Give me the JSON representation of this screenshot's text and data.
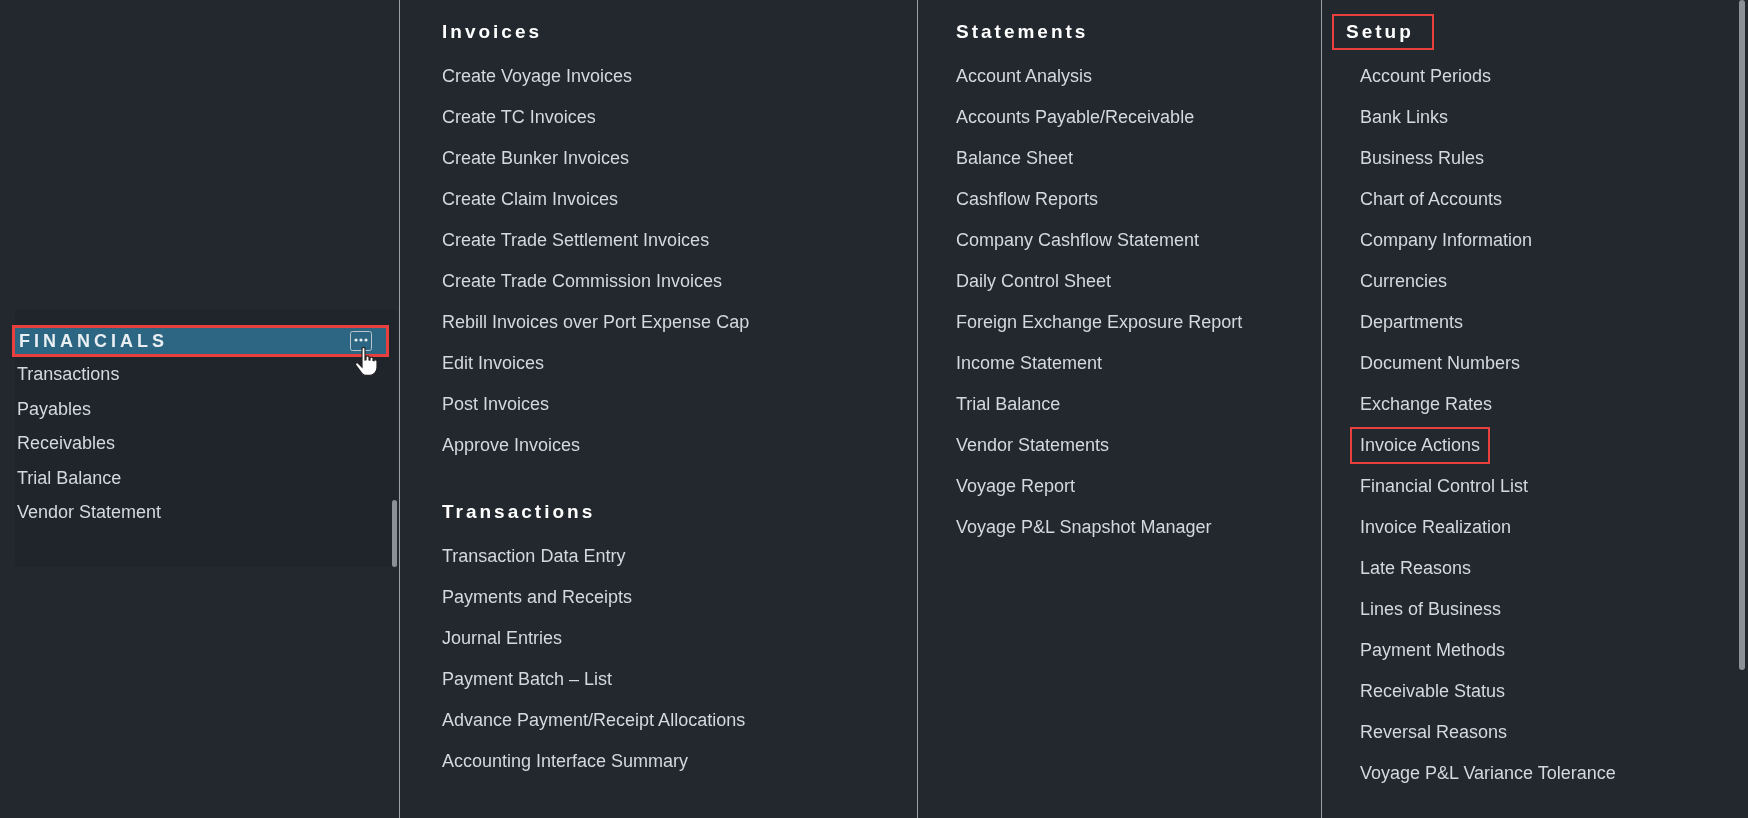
{
  "sidebar": {
    "section": {
      "label": "FINANCIALS",
      "selected": true,
      "highlighted": true
    },
    "items": [
      {
        "label": "Transactions"
      },
      {
        "label": "Payables"
      },
      {
        "label": "Receivables"
      },
      {
        "label": "Trial Balance"
      },
      {
        "label": "Vendor Statement"
      }
    ]
  },
  "menu_columns": [
    {
      "sections": [
        {
          "heading": "Invoices",
          "highlighted": false,
          "items": [
            {
              "label": "Create Voyage Invoices",
              "highlighted": false
            },
            {
              "label": "Create TC Invoices",
              "highlighted": false
            },
            {
              "label": "Create Bunker Invoices",
              "highlighted": false
            },
            {
              "label": "Create Claim Invoices",
              "highlighted": false
            },
            {
              "label": "Create Trade Settlement Invoices",
              "highlighted": false
            },
            {
              "label": "Create Trade Commission Invoices",
              "highlighted": false
            },
            {
              "label": "Rebill Invoices over Port Expense Cap",
              "highlighted": false
            },
            {
              "label": "Edit Invoices",
              "highlighted": false
            },
            {
              "label": "Post Invoices",
              "highlighted": false
            },
            {
              "label": "Approve Invoices",
              "highlighted": false
            }
          ]
        },
        {
          "heading": "Transactions",
          "highlighted": false,
          "items": [
            {
              "label": "Transaction Data Entry",
              "highlighted": false
            },
            {
              "label": "Payments and Receipts",
              "highlighted": false
            },
            {
              "label": "Journal Entries",
              "highlighted": false
            },
            {
              "label": "Payment Batch – List",
              "highlighted": false
            },
            {
              "label": "Advance Payment/Receipt Allocations",
              "highlighted": false
            },
            {
              "label": "Accounting Interface Summary",
              "highlighted": false
            }
          ]
        }
      ]
    },
    {
      "sections": [
        {
          "heading": "Statements",
          "highlighted": false,
          "items": [
            {
              "label": "Account Analysis",
              "highlighted": false
            },
            {
              "label": "Accounts Payable/Receivable",
              "highlighted": false
            },
            {
              "label": "Balance Sheet",
              "highlighted": false
            },
            {
              "label": "Cashflow Reports",
              "highlighted": false
            },
            {
              "label": "Company Cashflow Statement",
              "highlighted": false
            },
            {
              "label": "Daily Control Sheet",
              "highlighted": false
            },
            {
              "label": "Foreign Exchange Exposure Report",
              "highlighted": false
            },
            {
              "label": "Income Statement",
              "highlighted": false
            },
            {
              "label": "Trial Balance",
              "highlighted": false
            },
            {
              "label": "Vendor Statements",
              "highlighted": false
            },
            {
              "label": "Voyage Report",
              "highlighted": false
            },
            {
              "label": "Voyage P&L Snapshot Manager",
              "highlighted": false
            }
          ]
        }
      ]
    },
    {
      "sections": [
        {
          "heading": "Setup",
          "highlighted": true,
          "items": [
            {
              "label": "Account Periods",
              "highlighted": false
            },
            {
              "label": "Bank Links",
              "highlighted": false
            },
            {
              "label": "Business Rules",
              "highlighted": false
            },
            {
              "label": "Chart of Accounts",
              "highlighted": false
            },
            {
              "label": "Company Information",
              "highlighted": false
            },
            {
              "label": "Currencies",
              "highlighted": false
            },
            {
              "label": "Departments",
              "highlighted": false
            },
            {
              "label": "Document Numbers",
              "highlighted": false
            },
            {
              "label": "Exchange Rates",
              "highlighted": false
            },
            {
              "label": "Invoice Actions",
              "highlighted": true
            },
            {
              "label": "Financial Control List",
              "highlighted": false
            },
            {
              "label": "Invoice Realization",
              "highlighted": false
            },
            {
              "label": "Late Reasons",
              "highlighted": false
            },
            {
              "label": "Lines of Business",
              "highlighted": false
            },
            {
              "label": "Payment Methods",
              "highlighted": false
            },
            {
              "label": "Receivable Status",
              "highlighted": false
            },
            {
              "label": "Reversal Reasons",
              "highlighted": false
            },
            {
              "label": "Voyage P&L Variance Tolerance",
              "highlighted": false
            }
          ]
        }
      ]
    }
  ]
}
